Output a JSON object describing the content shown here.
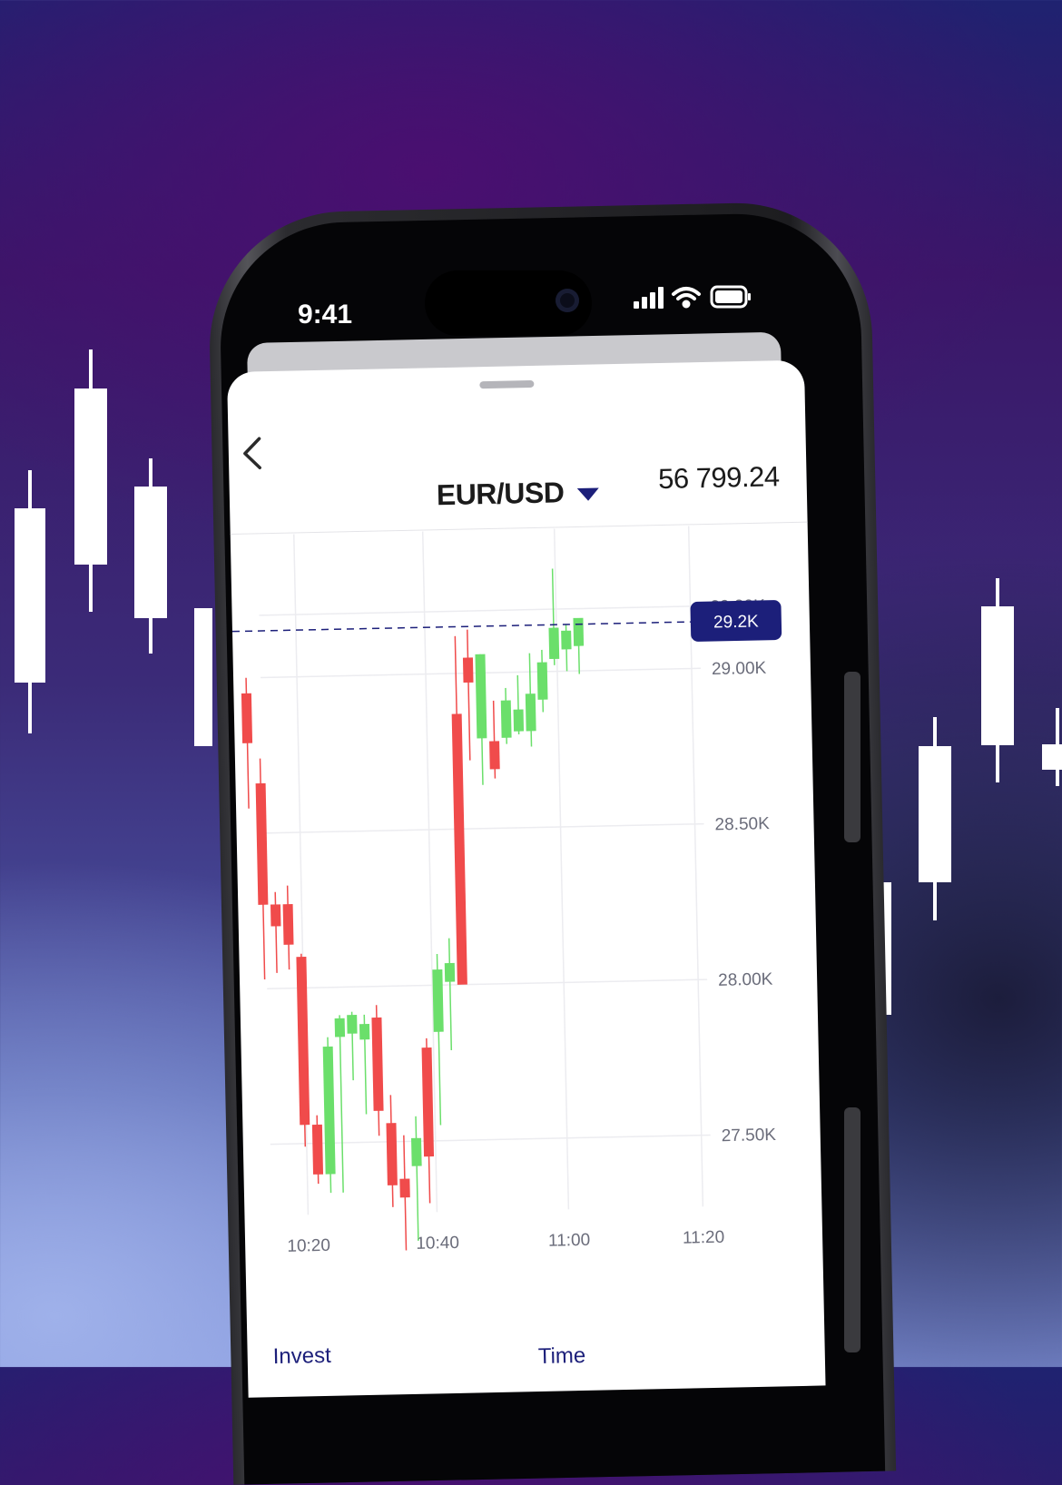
{
  "status_bar": {
    "time": "9:41"
  },
  "header": {
    "pair": "EUR/USD",
    "price": "56 799.24"
  },
  "chart_data": {
    "type": "candlestick",
    "y_ticks": [
      "29.20K",
      "29.00K",
      "28.50K",
      "28.00K",
      "27.50K"
    ],
    "x_ticks": [
      "10:20",
      "10:40",
      "11:00",
      "11:20"
    ],
    "current_price_label": "29.2K",
    "current_price": 29.15,
    "y_range": [
      27.3,
      29.4
    ],
    "grid": true,
    "candles": [
      {
        "o": 28.95,
        "h": 29.0,
        "l": 28.58,
        "c": 28.79
      },
      {
        "o": 28.66,
        "h": 28.74,
        "l": 28.03,
        "c": 28.27
      },
      {
        "o": 28.27,
        "h": 28.31,
        "l": 28.05,
        "c": 28.2
      },
      {
        "o": 28.27,
        "h": 28.33,
        "l": 28.06,
        "c": 28.14
      },
      {
        "o": 28.1,
        "h": 28.11,
        "l": 27.49,
        "c": 27.56
      },
      {
        "o": 27.56,
        "h": 27.59,
        "l": 27.37,
        "c": 27.4
      },
      {
        "o": 27.4,
        "h": 27.84,
        "l": 27.34,
        "c": 27.81
      },
      {
        "o": 27.84,
        "h": 27.91,
        "l": 27.34,
        "c": 27.9
      },
      {
        "o": 27.85,
        "h": 27.92,
        "l": 27.7,
        "c": 27.91
      },
      {
        "o": 27.83,
        "h": 27.91,
        "l": 27.59,
        "c": 27.88
      },
      {
        "o": 27.9,
        "h": 27.94,
        "l": 27.52,
        "c": 27.6
      },
      {
        "o": 27.56,
        "h": 27.65,
        "l": 27.29,
        "c": 27.36
      },
      {
        "o": 27.38,
        "h": 27.52,
        "l": 27.15,
        "c": 27.32
      },
      {
        "o": 27.42,
        "h": 27.58,
        "l": 27.18,
        "c": 27.51
      },
      {
        "o": 27.8,
        "h": 27.83,
        "l": 27.3,
        "c": 27.45
      },
      {
        "o": 27.85,
        "h": 28.1,
        "l": 27.55,
        "c": 28.05
      },
      {
        "o": 28.01,
        "h": 28.15,
        "l": 27.79,
        "c": 28.07
      },
      {
        "o": 28.87,
        "h": 29.12,
        "l": 28.01,
        "c": 28.0
      },
      {
        "o": 29.05,
        "h": 29.14,
        "l": 28.72,
        "c": 28.97
      },
      {
        "o": 28.79,
        "h": 29.06,
        "l": 28.64,
        "c": 29.06
      },
      {
        "o": 28.78,
        "h": 28.91,
        "l": 28.66,
        "c": 28.69
      },
      {
        "o": 28.79,
        "h": 28.95,
        "l": 28.77,
        "c": 28.91
      },
      {
        "o": 28.81,
        "h": 28.99,
        "l": 28.8,
        "c": 28.88
      },
      {
        "o": 28.81,
        "h": 29.06,
        "l": 28.76,
        "c": 28.93
      },
      {
        "o": 28.91,
        "h": 29.07,
        "l": 28.87,
        "c": 29.03
      },
      {
        "o": 29.04,
        "h": 29.33,
        "l": 29.02,
        "c": 29.14
      },
      {
        "o": 29.07,
        "h": 29.15,
        "l": 29.0,
        "c": 29.13
      },
      {
        "o": 29.08,
        "h": 29.16,
        "l": 28.99,
        "c": 29.17
      }
    ]
  },
  "bottom": {
    "invest_label": "Invest",
    "time_label": "Time"
  },
  "colors": {
    "up": "#6bdf6b",
    "down": "#f04b4b",
    "accent": "#1c1f7a",
    "grid": "#ececf0"
  }
}
